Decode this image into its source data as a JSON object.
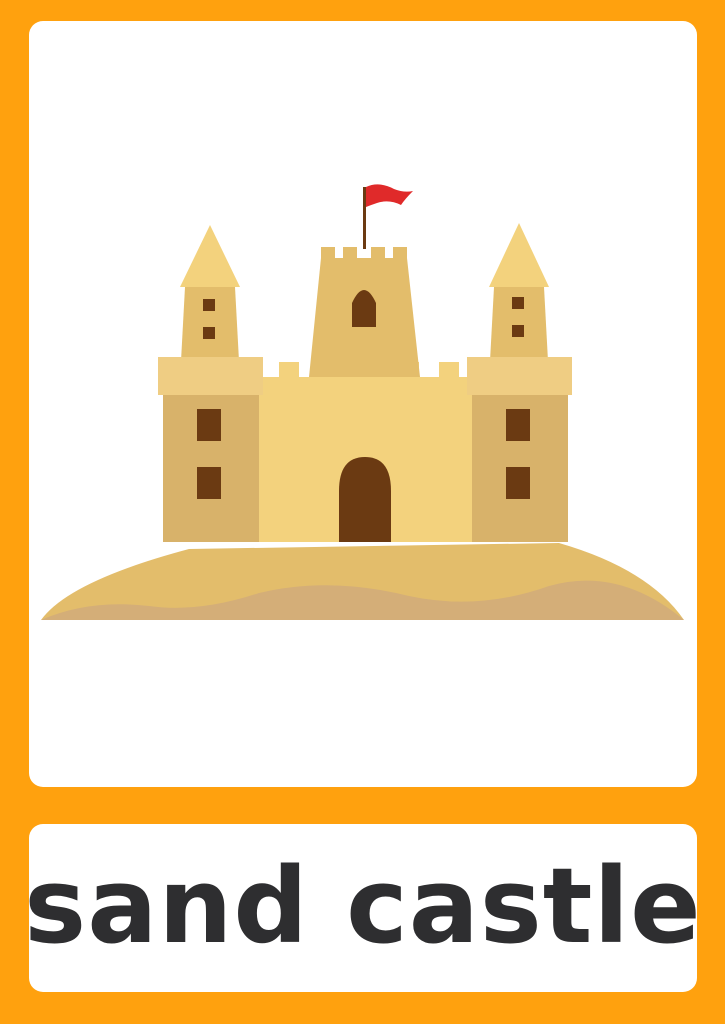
{
  "flashcard": {
    "word": "sand castle",
    "illustration_icon": "sand-castle-icon",
    "colors": {
      "border": "#FFA10E",
      "panel": "#FFFFFF",
      "text": "#2E2E30",
      "sand_light": "#F3D27D",
      "sand_mid": "#E3BD6B",
      "sand_dark": "#D8B26A",
      "door": "#6B3A12",
      "flag": "#E02A2A"
    }
  }
}
